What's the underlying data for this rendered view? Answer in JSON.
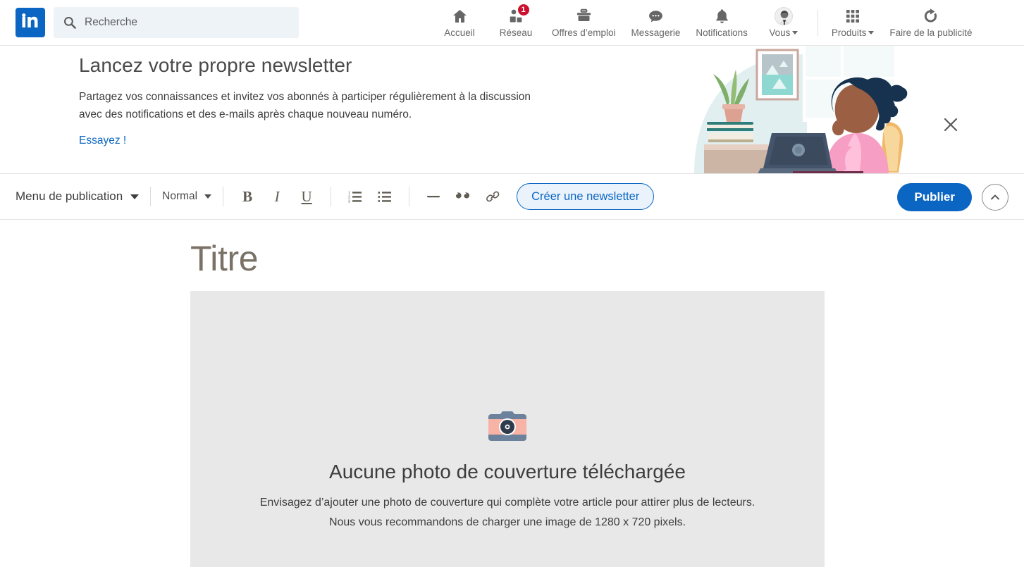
{
  "brand": {
    "name": "linkedin-logo",
    "text": "in"
  },
  "search": {
    "placeholder": "Recherche",
    "value": "",
    "icon": "search-icon"
  },
  "nav": {
    "items": [
      {
        "label": "Accueil",
        "icon": "home-icon",
        "badge": ""
      },
      {
        "label": "Réseau",
        "icon": "network-icon",
        "badge": "1"
      },
      {
        "label": "Offres d’emploi",
        "icon": "briefcase-icon",
        "badge": ""
      },
      {
        "label": "Messagerie",
        "icon": "message-icon",
        "badge": ""
      },
      {
        "label": "Notifications",
        "icon": "bell-icon",
        "badge": ""
      },
      {
        "label": "Vous",
        "icon": "avatar-icon",
        "badge": "",
        "dropdown": true
      }
    ],
    "secondary": [
      {
        "label": "Produits",
        "icon": "grid-icon",
        "dropdown": true
      },
      {
        "label": "Faire de la publicité",
        "icon": "advertise-icon",
        "dropdown": false
      }
    ]
  },
  "promo": {
    "title": "Lancez votre propre newsletter",
    "body": "Partagez vos connaissances et invitez vos abonnés à participer régulièrement à la discussion avec des notifications et des e-mails après chaque nouveau numéro.",
    "cta": "Essayez !",
    "close_icon": "close-icon",
    "illustration": "woman-at-laptop-illustration"
  },
  "toolbar": {
    "publish_menu": "Menu de publication",
    "text_style": "Normal",
    "bold": "B",
    "italic": "I",
    "underline": "U",
    "ordered_list_icon": "ordered-list-icon",
    "bullet_list_icon": "bullet-list-icon",
    "divider_icon": "horizontal-rule-icon",
    "quote_icon": "blockquote-icon",
    "link_icon": "link-icon",
    "newsletter_button": "Créer une newsletter",
    "publish_button": "Publier",
    "collapse_icon": "chevron-up-icon"
  },
  "article": {
    "title_placeholder": "Titre",
    "cover": {
      "icon": "camera-icon",
      "heading": "Aucune photo de couverture téléchargée",
      "line1": "Envisagez d’ajouter une photo de couverture qui complète votre article pour attirer plus de lecteurs.",
      "line2": "Nous vous recommandons de charger une image de 1280 x 720 pixels."
    }
  },
  "colors": {
    "brand_blue": "#0a66c2",
    "badge_red": "#cb112d",
    "cover_gray": "#e8e8e8",
    "title_placeholder": "#7a7266",
    "search_bg": "#eef3f8"
  }
}
